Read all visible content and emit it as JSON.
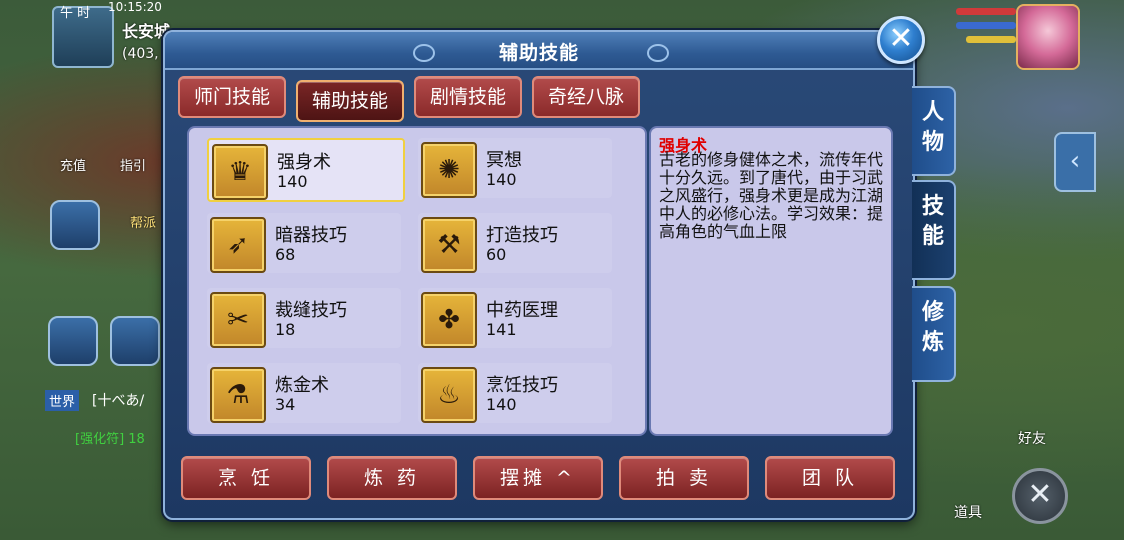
{
  "hud": {
    "time_label": "午 时",
    "clock": "10:15:20",
    "city": "长安城",
    "coords": "(403,",
    "recharge": "充值",
    "guide": "指引",
    "guild": "帮派",
    "world_chip": "世界",
    "world_msg": "[十べあ/",
    "buff_msg": "[强化符] 18",
    "friends": "好友",
    "items": "道具"
  },
  "dialog": {
    "title": "辅助技能",
    "close_symbol": "✕"
  },
  "tabs": [
    {
      "label": "师门技能",
      "active": false
    },
    {
      "label": "辅助技能",
      "active": true
    },
    {
      "label": "剧情技能",
      "active": false
    },
    {
      "label": "奇经八脉",
      "active": false
    }
  ],
  "skills": [
    {
      "name": "强身术",
      "level": "140",
      "icon": "strength-icon",
      "glyph": "♛",
      "selected": true
    },
    {
      "name": "冥想",
      "level": "140",
      "icon": "meditation-icon",
      "glyph": "✺",
      "selected": false
    },
    {
      "name": "暗器技巧",
      "level": "68",
      "icon": "dart-icon",
      "glyph": "➶",
      "selected": false
    },
    {
      "name": "打造技巧",
      "level": "60",
      "icon": "hammer-icon",
      "glyph": "⚒",
      "selected": false
    },
    {
      "name": "裁缝技巧",
      "level": "18",
      "icon": "scissors-icon",
      "glyph": "✂",
      "selected": false
    },
    {
      "name": "中药医理",
      "level": "141",
      "icon": "herb-icon",
      "glyph": "✤",
      "selected": false
    },
    {
      "name": "炼金术",
      "level": "34",
      "icon": "alchemy-icon",
      "glyph": "⚗",
      "selected": false
    },
    {
      "name": "烹饪技巧",
      "level": "140",
      "icon": "cooking-icon",
      "glyph": "♨",
      "selected": false
    }
  ],
  "description": {
    "title": "强身术",
    "text": "古老的修身健体之术，流传年代十分久远。到了唐代，由于习武之风盛行，强身术更是成为江湖中人的必修心法。学习效果：提高角色的气血上限"
  },
  "bottom_buttons": [
    {
      "label": "烹 饪",
      "name": "cooking-button"
    },
    {
      "label": "炼 药",
      "name": "refine-medicine-button"
    },
    {
      "label": "摆摊 ^",
      "name": "stall-button"
    },
    {
      "label": "拍 卖",
      "name": "auction-button"
    },
    {
      "label": "团 队",
      "name": "team-button"
    }
  ],
  "side_tabs": [
    {
      "label": "人物",
      "name": "side-tab-character",
      "active": false
    },
    {
      "label": "技能",
      "name": "side-tab-skills",
      "active": true
    },
    {
      "label": "修炼",
      "name": "side-tab-cultivation",
      "active": false
    }
  ]
}
